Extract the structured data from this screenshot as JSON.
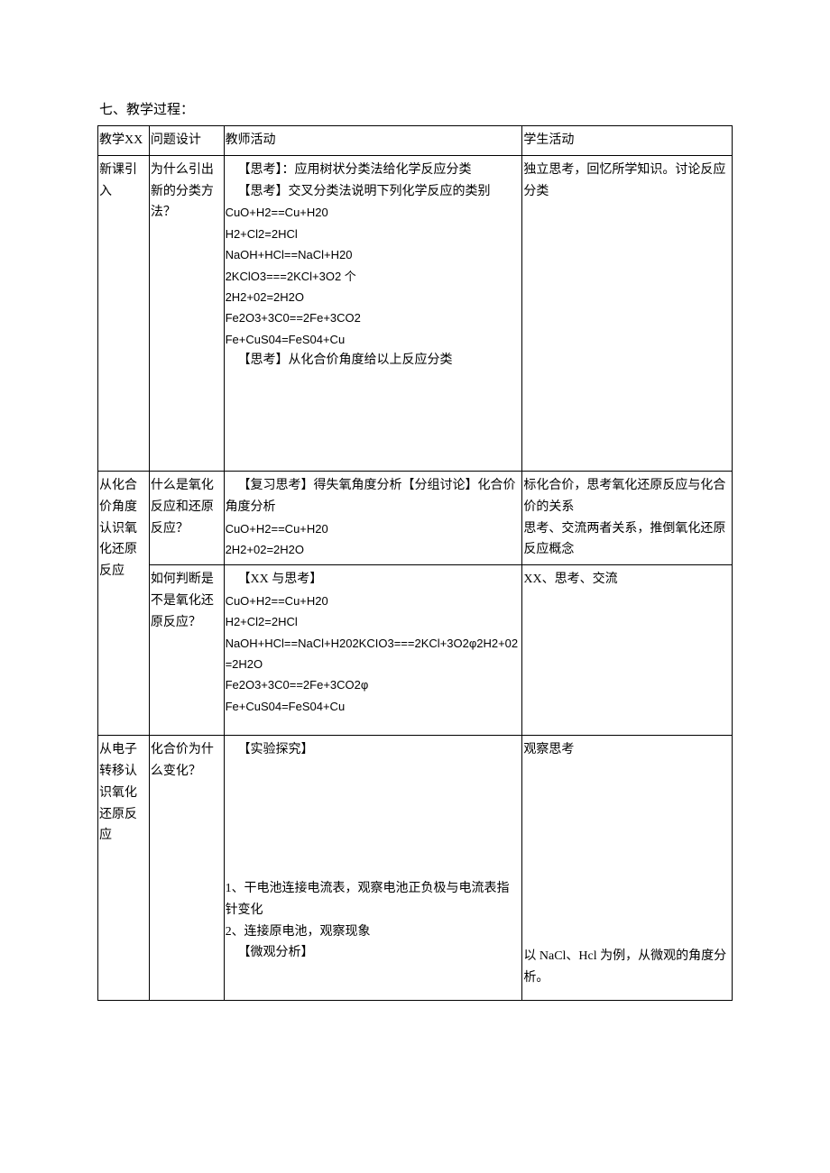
{
  "heading": "七、教学过程：",
  "header": {
    "c1": "教学XX",
    "c2": "问题设计",
    "c3": "教师活动",
    "c4": "学生活动"
  },
  "row1": {
    "c1": "新课引入",
    "c2": "为什么引出新的分类方法？",
    "c3_a": "【思考】：应用树状分类法给化学反应分类",
    "c3_b": "【思考】交叉分类法说明下列化学反应的类别",
    "c3_c": "CuO+H2==Cu+H20",
    "c3_d": "H2+Cl2=2HCl",
    "c3_e": "NaOH+HCl==NaCl+H20",
    "c3_f": "2KClO3===2KCl+3O2 个",
    "c3_g": "2H2+02=2H2O",
    "c3_h": "Fe2O3+3C0==2Fe+3CO2",
    "c3_i": "Fe+CuS04=FeS04+Cu",
    "c3_j": "【思考】从化合价角度给以上反应分类",
    "c4": "独立思考，回忆所学知识。讨论反应分类"
  },
  "row2": {
    "c1": "从化合价角度认识氧化还原反应",
    "c2a": "什么是氧化反应和还原反应？",
    "c3a_a": "【复习思考】得失氧角度分析【分组讨论】化合价角度分析",
    "c3a_b": "CuO+H2==Cu+H20",
    "c3a_c": "2H2+02=2H2O",
    "c4a": "标化合价，思考氧化还原反应与化合价的关系\n思考、交流两者关系，推倒氧化还原反应概念",
    "c2b": "如何判断是不是氧化还原反应？",
    "c3b_a": "【XX 与思考】",
    "c3b_b": "CuO+H2==Cu+H20",
    "c3b_c": "H2+Cl2=2HCl",
    "c3b_d": "NaOH+HCl==NaCl+H202KCIO3===2KCl+3O2φ2H2+02=2H2O",
    "c3b_e": "Fe2O3+3C0==2Fe+3CO2φ",
    "c3b_f": "Fe+CuS04=FeS04+Cu",
    "c4b": "XX、思考、交流"
  },
  "row3": {
    "c1": "从电子转移认识氧化还原反应",
    "c2": "化合价为什么变化？",
    "c3_a": "【实验探究】",
    "c3_b": "1、干电池连接电流表，观察电池正负极与电流表指针变化",
    "c3_c": "2、连接原电池，观察现象",
    "c3_d": "【微观分析】",
    "c4_a": "观察思考",
    "c4_b": "以 NaCl、Hcl 为例，从微观的角度分析。"
  }
}
